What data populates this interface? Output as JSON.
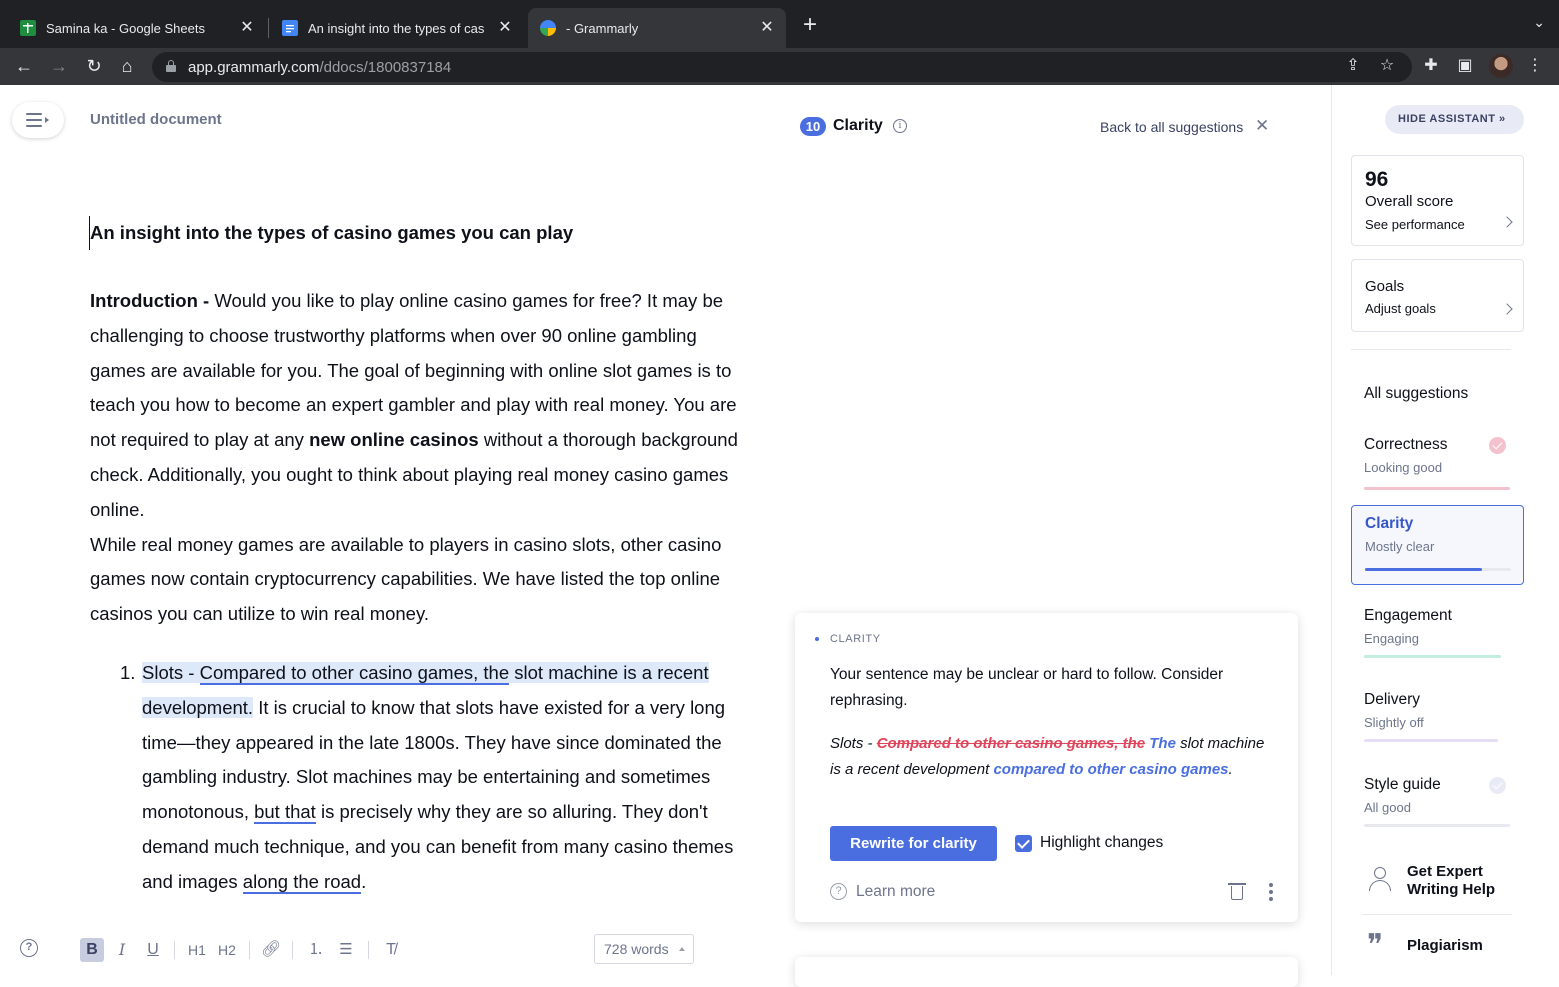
{
  "browser": {
    "tabs": [
      {
        "title": "Samina ka - Google Sheets",
        "active": false,
        "favicon": "google-sheets-icon"
      },
      {
        "title": "An insight into the types of cas",
        "active": false,
        "favicon": "google-docs-icon"
      },
      {
        "title": "- Grammarly",
        "active": true,
        "favicon": "grammarly-icon"
      }
    ],
    "url_host": "app.grammarly.com",
    "url_path": "/ddocs/1800837184"
  },
  "editor": {
    "doc_title": "Untitled document",
    "heading": "An insight into the types of casino games you can play",
    "intro_label": "Introduction -",
    "intro_text_1": " Would you like to play online casino games for free? It may be challenging to choose trustworthy platforms when over 90 online gambling games are available for you. The goal of beginning with online slot games is to teach you how to become an expert gambler and play with real money. You are not required to play at any ",
    "intro_bold": "new online casinos",
    "intro_text_2": " without a thorough background check. Additionally, you ought to think about playing real money casino games online.",
    "para2": "While real money games are available to players in casino slots, other casino games now contain cryptocurrency capabilities. We have listed the top online casinos you can utilize to win real money.",
    "list_num": "1.",
    "list_hl_1": "Slots - ",
    "list_hl_ul": "Compared to other casino games, the",
    "list_hl_2": " slot machine is a recent development.",
    "list_text_1": " It is crucial to know that slots have existed for a very long time—they appeared in the late 1800s. They have since dominated the gambling industry. Slot machines may be entertaining and sometimes monotonous, ",
    "list_ul_2": "but that",
    "list_text_2": " is precisely why they are so alluring. They don't demand much technique, and you can benefit from many casino themes and images ",
    "list_ul_3": "along the road",
    "list_text_3": ".",
    "word_count": "728 words",
    "format_buttons": {
      "bold": "B",
      "italic": "I",
      "underline": "U",
      "h1": "H1",
      "h2": "H2"
    }
  },
  "suggestions": {
    "count": "10",
    "header": "Clarity",
    "back_label": "Back to all suggestions",
    "card": {
      "category": "CLARITY",
      "message": "Your sentence may be unclear or hard to follow. Consider rephrasing.",
      "rw_prefix": "Slots - ",
      "rw_deleted": "Compared to other casino games, the",
      "rw_inserted_1": "The",
      "rw_mid": " slot machine is a recent development ",
      "rw_inserted_2": "compared to other casino games",
      "rw_end": ".",
      "button": "Rewrite for clarity",
      "checkbox_label": "Highlight changes",
      "checkbox_checked": true,
      "learn_more": "Learn more"
    }
  },
  "sidebar": {
    "hide_label": "HIDE ASSISTANT",
    "score": "96",
    "score_label": "Overall score",
    "score_sub": "See performance",
    "goals_label": "Goals",
    "goals_sub": "Adjust goals",
    "all_suggestions": "All suggestions",
    "categories": [
      {
        "name": "Correctness",
        "status": "Looking good",
        "color": "#f3c2cc",
        "progress": 1.0
      },
      {
        "name": "Clarity",
        "status": "Mostly clear",
        "color": "#4a6ee0",
        "progress": 0.8
      },
      {
        "name": "Engagement",
        "status": "Engaging",
        "color": "#c4eee0",
        "progress": 1.0
      },
      {
        "name": "Delivery",
        "status": "Slightly off",
        "color": "#e6ddf7",
        "progress": 1.0
      },
      {
        "name": "Style guide",
        "status": "All good",
        "color": "#e7e9ef",
        "progress": 1.0
      }
    ],
    "expert_label": "Get Expert Writing Help",
    "plagiarism_label": "Plagiarism"
  },
  "colors": {
    "accent": "#4a6ee0",
    "deleted": "#e0455c",
    "highlight": "#dde9f9"
  }
}
